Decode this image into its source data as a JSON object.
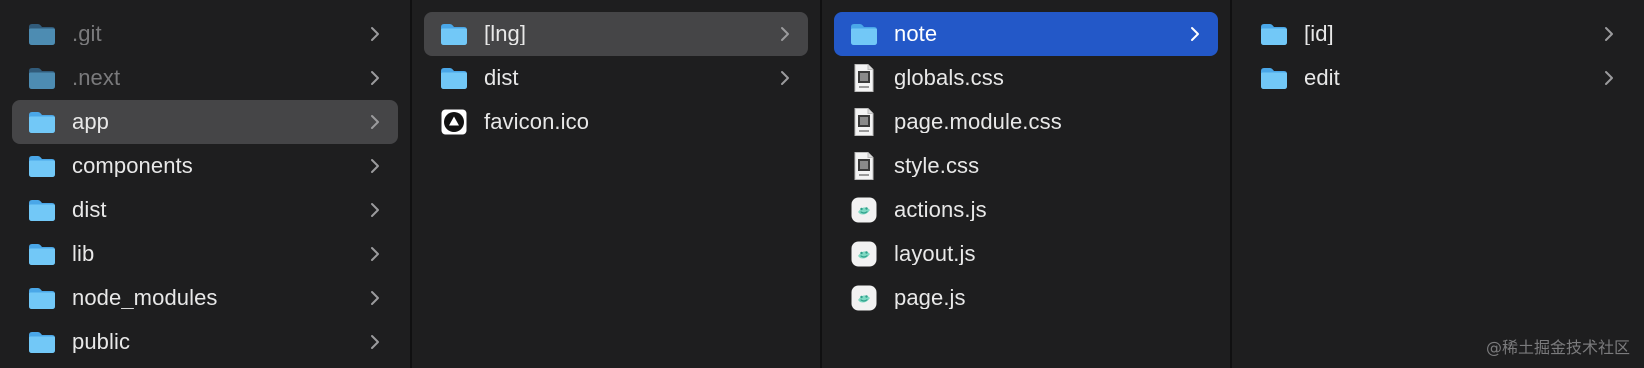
{
  "columns": [
    {
      "items": [
        {
          "label": ".git",
          "type": "folder",
          "state": "dim",
          "has_children": true
        },
        {
          "label": ".next",
          "type": "folder",
          "state": "dim",
          "has_children": true
        },
        {
          "label": "app",
          "type": "folder",
          "state": "selected-inactive",
          "has_children": true
        },
        {
          "label": "components",
          "type": "folder",
          "state": "normal",
          "has_children": true
        },
        {
          "label": "dist",
          "type": "folder",
          "state": "normal",
          "has_children": true
        },
        {
          "label": "lib",
          "type": "folder",
          "state": "normal",
          "has_children": true
        },
        {
          "label": "node_modules",
          "type": "folder",
          "state": "normal",
          "has_children": true
        },
        {
          "label": "public",
          "type": "folder",
          "state": "normal",
          "has_children": true
        }
      ]
    },
    {
      "items": [
        {
          "label": "[lng]",
          "type": "folder",
          "state": "selected-inactive",
          "has_children": true
        },
        {
          "label": "dist",
          "type": "folder",
          "state": "normal",
          "has_children": true
        },
        {
          "label": "favicon.ico",
          "type": "ico-file",
          "state": "normal",
          "has_children": false
        }
      ]
    },
    {
      "items": [
        {
          "label": "note",
          "type": "folder",
          "state": "selected-active",
          "has_children": true
        },
        {
          "label": "globals.css",
          "type": "css-file",
          "state": "normal",
          "has_children": false
        },
        {
          "label": "page.module.css",
          "type": "css-file",
          "state": "normal",
          "has_children": false
        },
        {
          "label": "style.css",
          "type": "css-file",
          "state": "normal",
          "has_children": false
        },
        {
          "label": "actions.js",
          "type": "js-file",
          "state": "normal",
          "has_children": false
        },
        {
          "label": "layout.js",
          "type": "js-file",
          "state": "normal",
          "has_children": false
        },
        {
          "label": "page.js",
          "type": "js-file",
          "state": "normal",
          "has_children": false
        }
      ]
    },
    {
      "items": [
        {
          "label": "[id]",
          "type": "folder",
          "state": "normal",
          "has_children": true
        },
        {
          "label": "edit",
          "type": "folder",
          "state": "normal",
          "has_children": true
        }
      ]
    }
  ],
  "icons": {
    "folder": "folder-icon",
    "ico-file": "favicon-file-icon",
    "css-file": "css-file-icon",
    "js-file": "js-file-icon",
    "chevron": "chevron-right-icon"
  },
  "colors": {
    "background": "#1e1e1f",
    "selected_active": "#2358c8",
    "selected_inactive": "#454547",
    "folder_light": "#6ec3f5",
    "folder_dark": "#4aa7e8"
  },
  "watermark": "@稀土掘金技术社区"
}
